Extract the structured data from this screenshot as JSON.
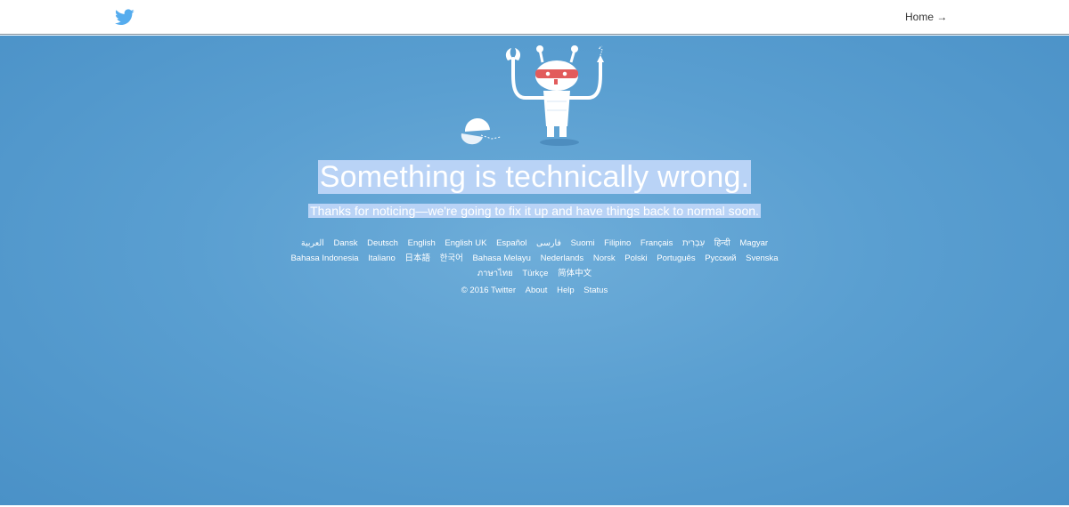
{
  "header": {
    "home_link": "Home →"
  },
  "main": {
    "headline": "Something is technically wrong.",
    "subline": "Thanks for noticing—we're going to fix it up and have things back to normal soon."
  },
  "languages": [
    "العربية",
    "Dansk",
    "Deutsch",
    "English",
    "English UK",
    "Español",
    "فارسی",
    "Suomi",
    "Filipino",
    "Français",
    "עִבְרִית",
    "हिन्दी",
    "Magyar",
    "Bahasa Indonesia",
    "Italiano",
    "日本語",
    "한국어",
    "Bahasa Melayu",
    "Nederlands",
    "Norsk",
    "Polski",
    "Português",
    "Русский",
    "Svenska",
    "ภาษาไทย",
    "Türkçe",
    "简体中文"
  ],
  "footer": {
    "copyright": "© 2016 Twitter",
    "about": "About",
    "help": "Help",
    "status": "Status"
  },
  "colors": {
    "background": "#5a9fd1",
    "highlight": "#b9d3f6",
    "brand": "#55acee"
  },
  "icons": {
    "logo": "twitter-bird-icon",
    "illustration": "robot-illustration"
  }
}
